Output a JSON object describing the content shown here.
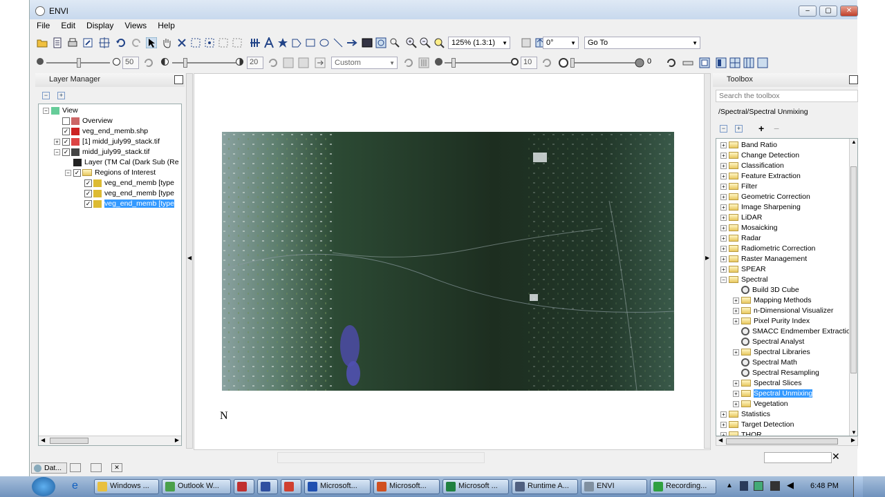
{
  "window": {
    "title": "ENVI",
    "min": "‒",
    "max": "▢",
    "close": "✕"
  },
  "menu": [
    "File",
    "Edit",
    "Display",
    "Views",
    "Help"
  ],
  "toolbar1": {
    "zoom_value": "125% (1.3:1)",
    "rotation_value": "0°",
    "goto_value": "Go To"
  },
  "toolbar2": {
    "brightness": "50",
    "contrast": "20",
    "stretch": "Custom",
    "sharpen": "10",
    "transparency": "0"
  },
  "layer_manager": {
    "title": "Layer Manager",
    "items": [
      {
        "label": "View",
        "indent": 0,
        "expand": "−",
        "check": "",
        "icon": "view"
      },
      {
        "label": "Overview",
        "indent": 1,
        "expand": "",
        "check": " ",
        "icon": "overview"
      },
      {
        "label": "veg_end_memb.shp",
        "indent": 1,
        "expand": "",
        "check": "✓",
        "icon": "shp"
      },
      {
        "label": "[1] midd_july99_stack.tif",
        "indent": 1,
        "expand": "+",
        "check": "✓",
        "icon": "raster"
      },
      {
        "label": "midd_july99_stack.tif",
        "indent": 1,
        "expand": "−",
        "check": "✓",
        "icon": "raster2"
      },
      {
        "label": "Layer (TM Cal (Dark Sub (Re",
        "indent": 2,
        "expand": "",
        "check": "",
        "icon": "layer"
      },
      {
        "label": "Regions of Interest",
        "indent": 2,
        "expand": "−",
        "check": "✓",
        "icon": "folder"
      },
      {
        "label": "veg_end_memb [type",
        "indent": 3,
        "expand": "",
        "check": "✓",
        "icon": "roi"
      },
      {
        "label": "veg_end_memb [type",
        "indent": 3,
        "expand": "",
        "check": "✓",
        "icon": "roi"
      },
      {
        "label": "veg_end_memb [type",
        "indent": 3,
        "expand": "",
        "check": "✓",
        "icon": "roi",
        "selected": true
      }
    ]
  },
  "toolbox": {
    "title": "Toolbox",
    "search_placeholder": "Search the toolbox",
    "path": "/Spectral/Spectral Unmixing",
    "items": [
      {
        "label": "Band Ratio",
        "type": "folder",
        "indent": 0
      },
      {
        "label": "Change Detection",
        "type": "folder",
        "indent": 0
      },
      {
        "label": "Classification",
        "type": "folder",
        "indent": 0
      },
      {
        "label": "Feature Extraction",
        "type": "folder",
        "indent": 0
      },
      {
        "label": "Filter",
        "type": "folder",
        "indent": 0
      },
      {
        "label": "Geometric Correction",
        "type": "folder",
        "indent": 0
      },
      {
        "label": "Image Sharpening",
        "type": "folder",
        "indent": 0
      },
      {
        "label": "LiDAR",
        "type": "folder",
        "indent": 0
      },
      {
        "label": "Mosaicking",
        "type": "folder",
        "indent": 0
      },
      {
        "label": "Radar",
        "type": "folder",
        "indent": 0
      },
      {
        "label": "Radiometric Correction",
        "type": "folder",
        "indent": 0
      },
      {
        "label": "Raster Management",
        "type": "folder",
        "indent": 0
      },
      {
        "label": "SPEAR",
        "type": "folder",
        "indent": 0
      },
      {
        "label": "Spectral",
        "type": "folder-open",
        "indent": 0
      },
      {
        "label": "Build 3D Cube",
        "type": "tool",
        "indent": 1
      },
      {
        "label": "Mapping Methods",
        "type": "folder",
        "indent": 1
      },
      {
        "label": "n-Dimensional Visualizer",
        "type": "folder",
        "indent": 1
      },
      {
        "label": "Pixel Purity Index",
        "type": "folder",
        "indent": 1
      },
      {
        "label": "SMACC Endmember Extractio",
        "type": "tool",
        "indent": 1
      },
      {
        "label": "Spectral Analyst",
        "type": "tool",
        "indent": 1
      },
      {
        "label": "Spectral Libraries",
        "type": "folder",
        "indent": 1
      },
      {
        "label": "Spectral Math",
        "type": "tool",
        "indent": 1
      },
      {
        "label": "Spectral Resampling",
        "type": "tool",
        "indent": 1
      },
      {
        "label": "Spectral Slices",
        "type": "folder",
        "indent": 1
      },
      {
        "label": "Spectral Unmixing",
        "type": "folder",
        "indent": 1,
        "selected": true
      },
      {
        "label": "Vegetation",
        "type": "folder",
        "indent": 1
      },
      {
        "label": "Statistics",
        "type": "folder",
        "indent": 0
      },
      {
        "label": "Target Detection",
        "type": "folder",
        "indent": 0
      },
      {
        "label": "THOR",
        "type": "folder",
        "indent": 0
      }
    ]
  },
  "view": {
    "north_label": "N"
  },
  "data_manager_tab": {
    "label": "Dat..."
  },
  "taskbar": {
    "tasks": [
      {
        "label": "Windows ...",
        "color": "#e8c040"
      },
      {
        "label": "Outlook W...",
        "color": "#4aa04a"
      },
      {
        "label": "",
        "color": "#c03030"
      },
      {
        "label": "",
        "color": "#3050a0"
      },
      {
        "label": "",
        "color": "#d04030"
      },
      {
        "label": "Microsoft...",
        "color": "#2050b0"
      },
      {
        "label": "Microsoft...",
        "color": "#d05020"
      },
      {
        "label": "Microsoft ...",
        "color": "#208040"
      },
      {
        "label": "Runtime A...",
        "color": "#506080"
      },
      {
        "label": "ENVI",
        "color": "#8090a0"
      },
      {
        "label": "Recording...",
        "color": "#30a040"
      }
    ],
    "clock": "6:48 PM"
  }
}
